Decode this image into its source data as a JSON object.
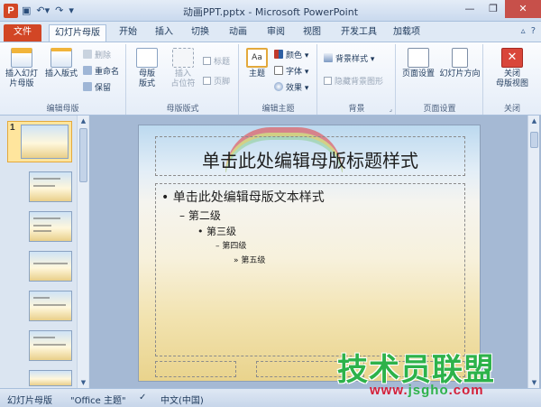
{
  "titlebar": {
    "title": "动画PPT.pptx - Microsoft PowerPoint",
    "app_icon": "P",
    "qat": [
      "save-icon",
      "undo-icon",
      "redo-icon",
      "customize-icon"
    ],
    "window_buttons": [
      "minimize-icon",
      "restore-icon",
      "close-icon"
    ]
  },
  "tabs": [
    {
      "label": "文件"
    },
    {
      "label": "幻灯片母版"
    },
    {
      "label": "开始"
    },
    {
      "label": "插入"
    },
    {
      "label": "切换"
    },
    {
      "label": "动画"
    },
    {
      "label": "审阅"
    },
    {
      "label": "视图"
    },
    {
      "label": "开发工具"
    },
    {
      "label": "加载项"
    }
  ],
  "ribbon": {
    "edit_master": {
      "label": "编辑母版",
      "insert_master_line1": "插入幻灯",
      "insert_master_line2": "片母版",
      "insert_layout": "插入版式",
      "delete": "删除",
      "rename": "重命名",
      "preserve": "保留"
    },
    "master_layout": {
      "label": "母版版式",
      "master_layout_line1": "母版",
      "master_layout_line2": "版式",
      "insert_placeholder_line1": "插入",
      "insert_placeholder_line2": "占位符",
      "title": "标题",
      "footers": "页脚"
    },
    "edit_theme": {
      "label": "编辑主题",
      "themes": "主题",
      "colors": "颜色",
      "fonts": "字体",
      "effects": "效果"
    },
    "background": {
      "label": "背景",
      "background_styles": "背景样式",
      "hide_background": "隐藏背景图形"
    },
    "page_setup": {
      "label": "页面设置",
      "page_setup": "页面设置",
      "orientation": "幻灯片方向"
    },
    "close": {
      "label": "关闭",
      "close_line1": "关闭",
      "close_line2": "母版视图"
    }
  },
  "thumbnails": {
    "selected_number": "1"
  },
  "slide": {
    "title": "单击此处编辑母版标题样式",
    "levels": [
      "单击此处编辑母版文本样式",
      "第二级",
      "第三级",
      "第四级",
      "第五级"
    ],
    "bullets": [
      "•",
      "–",
      "•",
      "–",
      "»"
    ]
  },
  "statusbar": {
    "view": "幻灯片母版",
    "theme": "\"Office 主题\"",
    "language": "中文(中国)"
  },
  "watermark": {
    "text": "技术员联盟",
    "url_prefix": "www.",
    "url_main": "jsgho",
    "url_suffix": ".com"
  },
  "colors": {
    "file_tab": "#d24625",
    "ribbon_accent": "#1e395b",
    "watermark_green": "#2db24a",
    "watermark_red": "#d4203a"
  }
}
